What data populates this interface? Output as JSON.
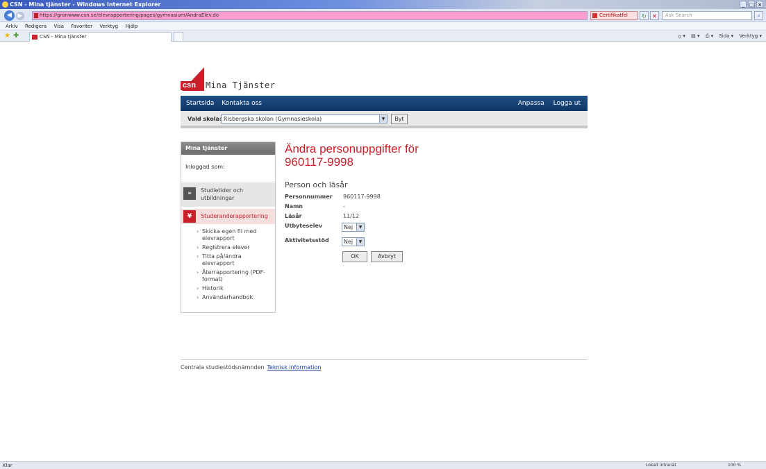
{
  "browser": {
    "window_title": "CSN - Mina tjänster - Windows Internet Explorer",
    "url": "https://gronwww.csn.se/elevrapportering/pages/gymnasium/AndraElev.do",
    "certificate_label": "Certifikatfel",
    "search_placeholder": "Ask Search",
    "menu": [
      "Arkiv",
      "Redigera",
      "Visa",
      "Favoriter",
      "Verktyg",
      "Hjälp"
    ],
    "tab_title": "CSN - Mina tjänster",
    "commands": [
      "Sida ▾",
      "Verktyg ▾"
    ],
    "status_text": "Klar",
    "status_zone": "Lokalt intranät",
    "zoom": "100 %"
  },
  "header": {
    "logo_mark": "csn",
    "logo_text": "Mina Tjänster",
    "nav_left": [
      "Startsida",
      "Kontakta oss"
    ],
    "nav_right": [
      "Anpassa",
      "Logga ut"
    ],
    "school_label": "Vald skola:",
    "school_selected": "Risbergska skolan (Gymnasieskola)",
    "byt_label": "Byt"
  },
  "sidebar": {
    "title": "Mina tjänster",
    "logged_in_label": "Inloggad som:",
    "items": [
      {
        "label": "Studietider och utbildningar",
        "icon": "double-chevron-right-icon"
      },
      {
        "label": "Studeranderapportering",
        "icon": "double-chevron-down-icon"
      }
    ],
    "subitems": [
      "Skicka egen fil med elevrapport",
      "Registrera elever",
      "Titta på/ändra elevrapport",
      "Återrapportering (PDF-format)",
      "Historik",
      "Användarhandbok"
    ]
  },
  "main": {
    "title_line1": "Ändra personuppgifter för",
    "title_line2": "960117-9998",
    "section_title": "Person och läsår",
    "fields": [
      {
        "label": "Personnummer",
        "value": "960117-9998"
      },
      {
        "label": "Namn",
        "value": "-"
      },
      {
        "label": "Läsår",
        "value": "11/12"
      }
    ],
    "utbyteselev_label": "Utbyteselev",
    "utbyteselev_value": "Nej",
    "aktivitetsstod_label": "Aktivitetsstöd",
    "aktivitetsstod_value": "Nej",
    "ok_label": "OK",
    "cancel_label": "Avbryt"
  },
  "footer": {
    "org": "Centrala studiestödsnämnden",
    "link": "Teknisk information"
  },
  "colors": {
    "brand_red": "#c9202a",
    "nav_blue": "#1f4e86"
  }
}
